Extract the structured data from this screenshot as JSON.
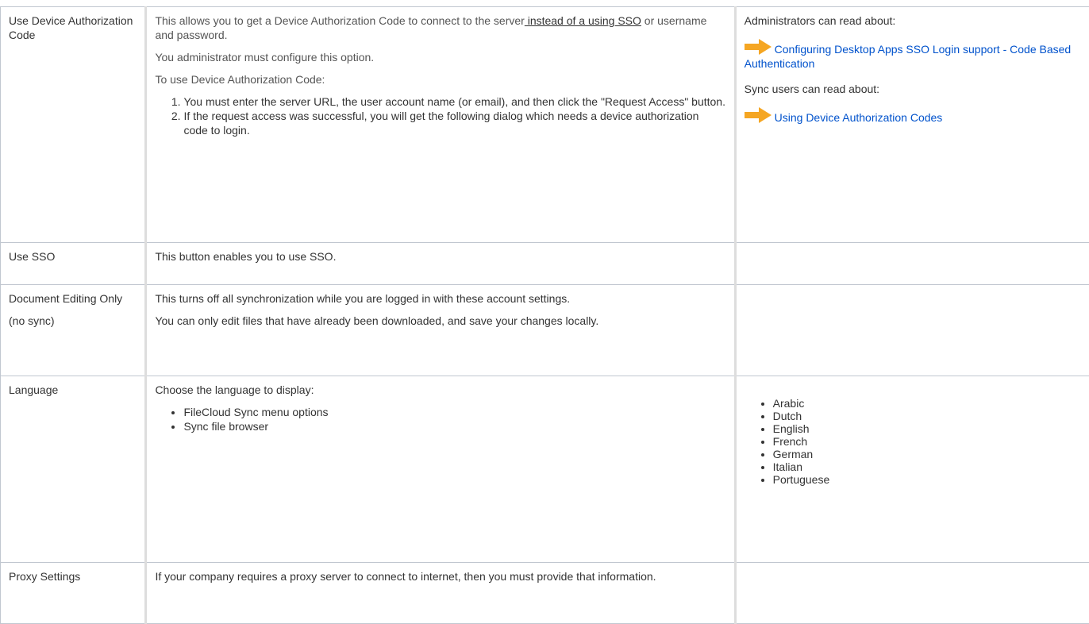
{
  "rows": {
    "device_auth": {
      "label": "Use Device Authorization Code",
      "desc_lead": "This allows you to get a Device Authorization Code to connect to the server",
      "desc_link": " instead of a using SSO",
      "desc_tail": " or username and password.",
      "admin_note": "You administrator must configure this option.",
      "steps_intro": "To use Device Authorization Code:",
      "steps": [
        "You must enter the server URL, the user account name (or email), and then click the \"Request Access\" button.",
        "If the request access was successful, you will get the following dialog which needs a device authorization code to login."
      ],
      "admins_heading": "Administrators can read about:",
      "admin_link": "Configuring Desktop Apps SSO Login support - Code Based Authentication",
      "sync_heading": "Sync users can read about:",
      "sync_link": "Using Device Authorization Codes",
      "icon": "orange-arrow-icon"
    },
    "sso": {
      "label": "Use SSO",
      "desc": "This button enables you to use SSO."
    },
    "doc_editing": {
      "label": "Document Editing Only",
      "label_sub": "(no sync)",
      "desc1": "This turns off all synchronization while you are logged in with these account settings.",
      "desc2": "You can only edit files that have already been downloaded, and save your changes locally."
    },
    "language": {
      "label": "Language",
      "desc": "Choose the language to display:",
      "display_items": [
        "FileCloud Sync menu options",
        "Sync file browser"
      ],
      "languages": [
        "Arabic",
        "Dutch",
        "English",
        "French",
        "German",
        "Italian",
        "Portuguese"
      ]
    },
    "proxy": {
      "label": "Proxy Settings",
      "desc": "If your company requires a proxy server to connect to internet, then you must provide that information."
    }
  },
  "colors": {
    "link": "#0052cc",
    "border": "#c1c7d0",
    "text": "#333333",
    "arrow": "#f5a623"
  }
}
